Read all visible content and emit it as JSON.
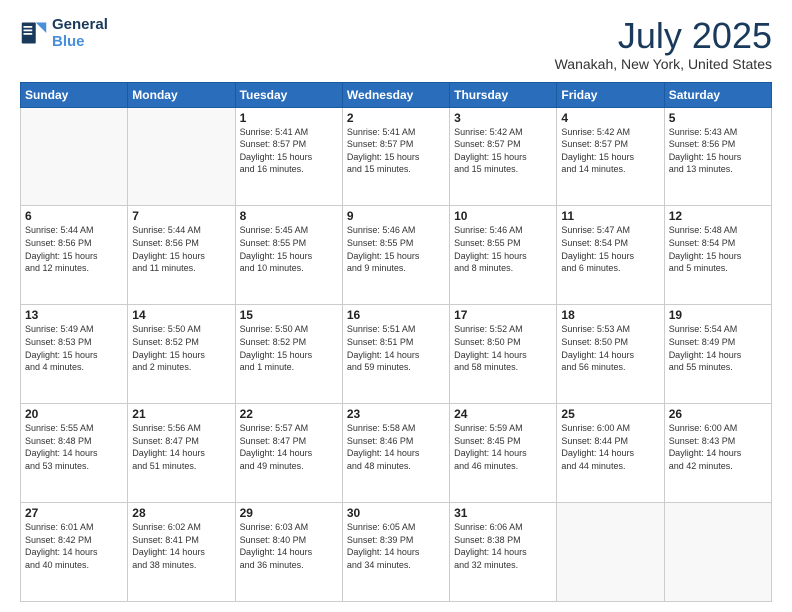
{
  "header": {
    "logo_line1": "General",
    "logo_line2": "Blue",
    "title": "July 2025",
    "subtitle": "Wanakah, New York, United States"
  },
  "columns": [
    "Sunday",
    "Monday",
    "Tuesday",
    "Wednesday",
    "Thursday",
    "Friday",
    "Saturday"
  ],
  "weeks": [
    [
      {
        "day": "",
        "info": ""
      },
      {
        "day": "",
        "info": ""
      },
      {
        "day": "1",
        "info": "Sunrise: 5:41 AM\nSunset: 8:57 PM\nDaylight: 15 hours\nand 16 minutes."
      },
      {
        "day": "2",
        "info": "Sunrise: 5:41 AM\nSunset: 8:57 PM\nDaylight: 15 hours\nand 15 minutes."
      },
      {
        "day": "3",
        "info": "Sunrise: 5:42 AM\nSunset: 8:57 PM\nDaylight: 15 hours\nand 15 minutes."
      },
      {
        "day": "4",
        "info": "Sunrise: 5:42 AM\nSunset: 8:57 PM\nDaylight: 15 hours\nand 14 minutes."
      },
      {
        "day": "5",
        "info": "Sunrise: 5:43 AM\nSunset: 8:56 PM\nDaylight: 15 hours\nand 13 minutes."
      }
    ],
    [
      {
        "day": "6",
        "info": "Sunrise: 5:44 AM\nSunset: 8:56 PM\nDaylight: 15 hours\nand 12 minutes."
      },
      {
        "day": "7",
        "info": "Sunrise: 5:44 AM\nSunset: 8:56 PM\nDaylight: 15 hours\nand 11 minutes."
      },
      {
        "day": "8",
        "info": "Sunrise: 5:45 AM\nSunset: 8:55 PM\nDaylight: 15 hours\nand 10 minutes."
      },
      {
        "day": "9",
        "info": "Sunrise: 5:46 AM\nSunset: 8:55 PM\nDaylight: 15 hours\nand 9 minutes."
      },
      {
        "day": "10",
        "info": "Sunrise: 5:46 AM\nSunset: 8:55 PM\nDaylight: 15 hours\nand 8 minutes."
      },
      {
        "day": "11",
        "info": "Sunrise: 5:47 AM\nSunset: 8:54 PM\nDaylight: 15 hours\nand 6 minutes."
      },
      {
        "day": "12",
        "info": "Sunrise: 5:48 AM\nSunset: 8:54 PM\nDaylight: 15 hours\nand 5 minutes."
      }
    ],
    [
      {
        "day": "13",
        "info": "Sunrise: 5:49 AM\nSunset: 8:53 PM\nDaylight: 15 hours\nand 4 minutes."
      },
      {
        "day": "14",
        "info": "Sunrise: 5:50 AM\nSunset: 8:52 PM\nDaylight: 15 hours\nand 2 minutes."
      },
      {
        "day": "15",
        "info": "Sunrise: 5:50 AM\nSunset: 8:52 PM\nDaylight: 15 hours\nand 1 minute."
      },
      {
        "day": "16",
        "info": "Sunrise: 5:51 AM\nSunset: 8:51 PM\nDaylight: 14 hours\nand 59 minutes."
      },
      {
        "day": "17",
        "info": "Sunrise: 5:52 AM\nSunset: 8:50 PM\nDaylight: 14 hours\nand 58 minutes."
      },
      {
        "day": "18",
        "info": "Sunrise: 5:53 AM\nSunset: 8:50 PM\nDaylight: 14 hours\nand 56 minutes."
      },
      {
        "day": "19",
        "info": "Sunrise: 5:54 AM\nSunset: 8:49 PM\nDaylight: 14 hours\nand 55 minutes."
      }
    ],
    [
      {
        "day": "20",
        "info": "Sunrise: 5:55 AM\nSunset: 8:48 PM\nDaylight: 14 hours\nand 53 minutes."
      },
      {
        "day": "21",
        "info": "Sunrise: 5:56 AM\nSunset: 8:47 PM\nDaylight: 14 hours\nand 51 minutes."
      },
      {
        "day": "22",
        "info": "Sunrise: 5:57 AM\nSunset: 8:47 PM\nDaylight: 14 hours\nand 49 minutes."
      },
      {
        "day": "23",
        "info": "Sunrise: 5:58 AM\nSunset: 8:46 PM\nDaylight: 14 hours\nand 48 minutes."
      },
      {
        "day": "24",
        "info": "Sunrise: 5:59 AM\nSunset: 8:45 PM\nDaylight: 14 hours\nand 46 minutes."
      },
      {
        "day": "25",
        "info": "Sunrise: 6:00 AM\nSunset: 8:44 PM\nDaylight: 14 hours\nand 44 minutes."
      },
      {
        "day": "26",
        "info": "Sunrise: 6:00 AM\nSunset: 8:43 PM\nDaylight: 14 hours\nand 42 minutes."
      }
    ],
    [
      {
        "day": "27",
        "info": "Sunrise: 6:01 AM\nSunset: 8:42 PM\nDaylight: 14 hours\nand 40 minutes."
      },
      {
        "day": "28",
        "info": "Sunrise: 6:02 AM\nSunset: 8:41 PM\nDaylight: 14 hours\nand 38 minutes."
      },
      {
        "day": "29",
        "info": "Sunrise: 6:03 AM\nSunset: 8:40 PM\nDaylight: 14 hours\nand 36 minutes."
      },
      {
        "day": "30",
        "info": "Sunrise: 6:05 AM\nSunset: 8:39 PM\nDaylight: 14 hours\nand 34 minutes."
      },
      {
        "day": "31",
        "info": "Sunrise: 6:06 AM\nSunset: 8:38 PM\nDaylight: 14 hours\nand 32 minutes."
      },
      {
        "day": "",
        "info": ""
      },
      {
        "day": "",
        "info": ""
      }
    ]
  ]
}
